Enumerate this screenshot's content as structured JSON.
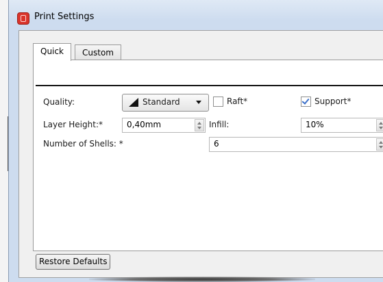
{
  "window": {
    "title": "Print Settings"
  },
  "tabs": [
    {
      "label": "Quick",
      "active": true
    },
    {
      "label": "Custom",
      "active": false
    }
  ],
  "quality": {
    "label": "Quality:",
    "selected": "Standard"
  },
  "raft": {
    "label": "Raft*",
    "checked": false
  },
  "support": {
    "label": "Support*",
    "checked": true
  },
  "layer_height": {
    "label": "Layer Height:*",
    "value": "0,40mm"
  },
  "infill": {
    "label": "Infill:",
    "value": "10%"
  },
  "shells": {
    "label": "Number of Shells: *",
    "value": "6"
  },
  "buttons": {
    "restore_defaults": "Restore Defaults"
  },
  "colors": {
    "title_bar": "#cddcef",
    "app_icon": "#d9342b",
    "check": "#3a6fc9"
  },
  "icons": [
    "app-logo-icon",
    "quality-level-icon",
    "dropdown-arrow-icon",
    "checkmark-icon",
    "spin-up-icon",
    "spin-down-icon"
  ]
}
